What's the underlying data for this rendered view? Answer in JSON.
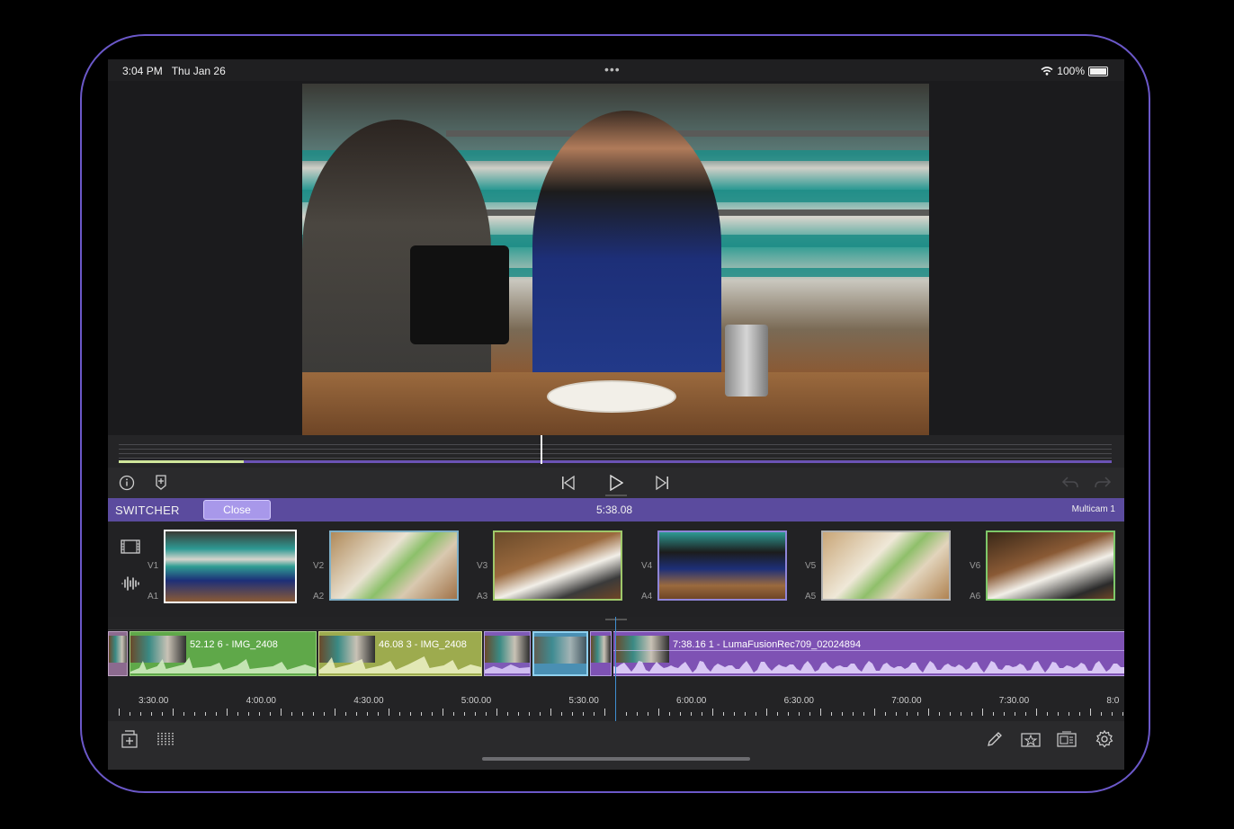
{
  "status_bar": {
    "time": "3:04 PM",
    "date": "Thu Jan 26",
    "battery": "100%",
    "more": "•••"
  },
  "transport": {
    "info_icon": "info-icon",
    "marker_icon": "marker-icon",
    "prev_icon": "skip-back-icon",
    "play_icon": "play-icon",
    "next_icon": "skip-forward-icon"
  },
  "switcher": {
    "title": "SWITCHER",
    "close_label": "Close",
    "timecode": "5:38.08",
    "multicam_name": "Multicam 1"
  },
  "angles": [
    {
      "video": "V1",
      "audio": "A1",
      "selected": true,
      "color": "#b8a8f0"
    },
    {
      "video": "V2",
      "audio": "A2",
      "selected": false,
      "color": "#7fb0c8"
    },
    {
      "video": "V3",
      "audio": "A3",
      "selected": false,
      "color": "#9fc86a"
    },
    {
      "video": "V4",
      "audio": "A4",
      "selected": false,
      "color": "#8f85d8"
    },
    {
      "video": "V5",
      "audio": "A5",
      "selected": false,
      "color": "#b0b0b0"
    },
    {
      "video": "V6",
      "audio": "A6",
      "selected": false,
      "color": "#7ec86a"
    }
  ],
  "timeline": {
    "clips": [
      {
        "label": "52.12  6 - IMG_2408",
        "color": "#5fa849"
      },
      {
        "label": "46.08  3 - IMG_2408",
        "color": "#9dab4e"
      },
      {
        "label": "",
        "color": "#7e5ab6"
      },
      {
        "label": "",
        "color": "#4a8fb3"
      },
      {
        "label": "7:38.16  1 - LumaFusionRec709_02024894",
        "color": "#7e52b4"
      }
    ],
    "ruler_labels": [
      "3:30.00",
      "4:00.00",
      "4:30.00",
      "5:00.00",
      "5:30.00",
      "6:00.00",
      "6:30.00",
      "7:00.00",
      "7:30.00",
      "8:0"
    ]
  },
  "toolbar": {
    "left": [
      "add-media-icon",
      "audio-meter-icon"
    ],
    "right": [
      "pencil-icon",
      "favorite-icon",
      "export-icon",
      "settings-icon"
    ]
  },
  "colors": {
    "accent": "#5b4b9e",
    "frame": "#6b58c9",
    "playhead": "#3f8fd2"
  }
}
